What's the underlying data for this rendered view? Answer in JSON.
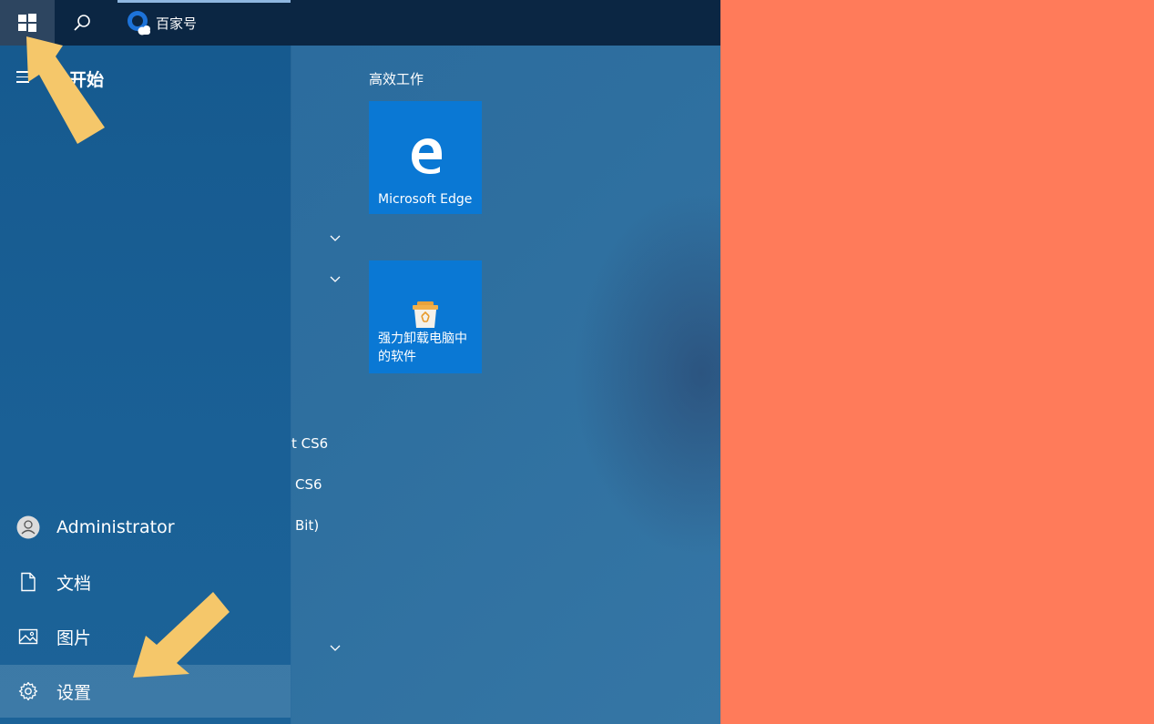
{
  "taskbar": {
    "app_label": "百家号"
  },
  "start_menu": {
    "title": "开始",
    "rail": {
      "user": "Administrator",
      "documents": "文档",
      "pictures": "图片",
      "settings": "设置"
    },
    "app_list_fragments": [
      "t CS6",
      "CS6",
      "Bit)"
    ],
    "tile_group": "高效工作",
    "tiles": [
      {
        "label": "Microsoft Edge"
      },
      {
        "label": "强力卸载电脑中的软件"
      }
    ]
  },
  "colors": {
    "taskbar": "#0b2643",
    "tile": "#0a78d4",
    "background_right": "#ff7b5a",
    "annotation_arrow": "#f5c76a"
  }
}
